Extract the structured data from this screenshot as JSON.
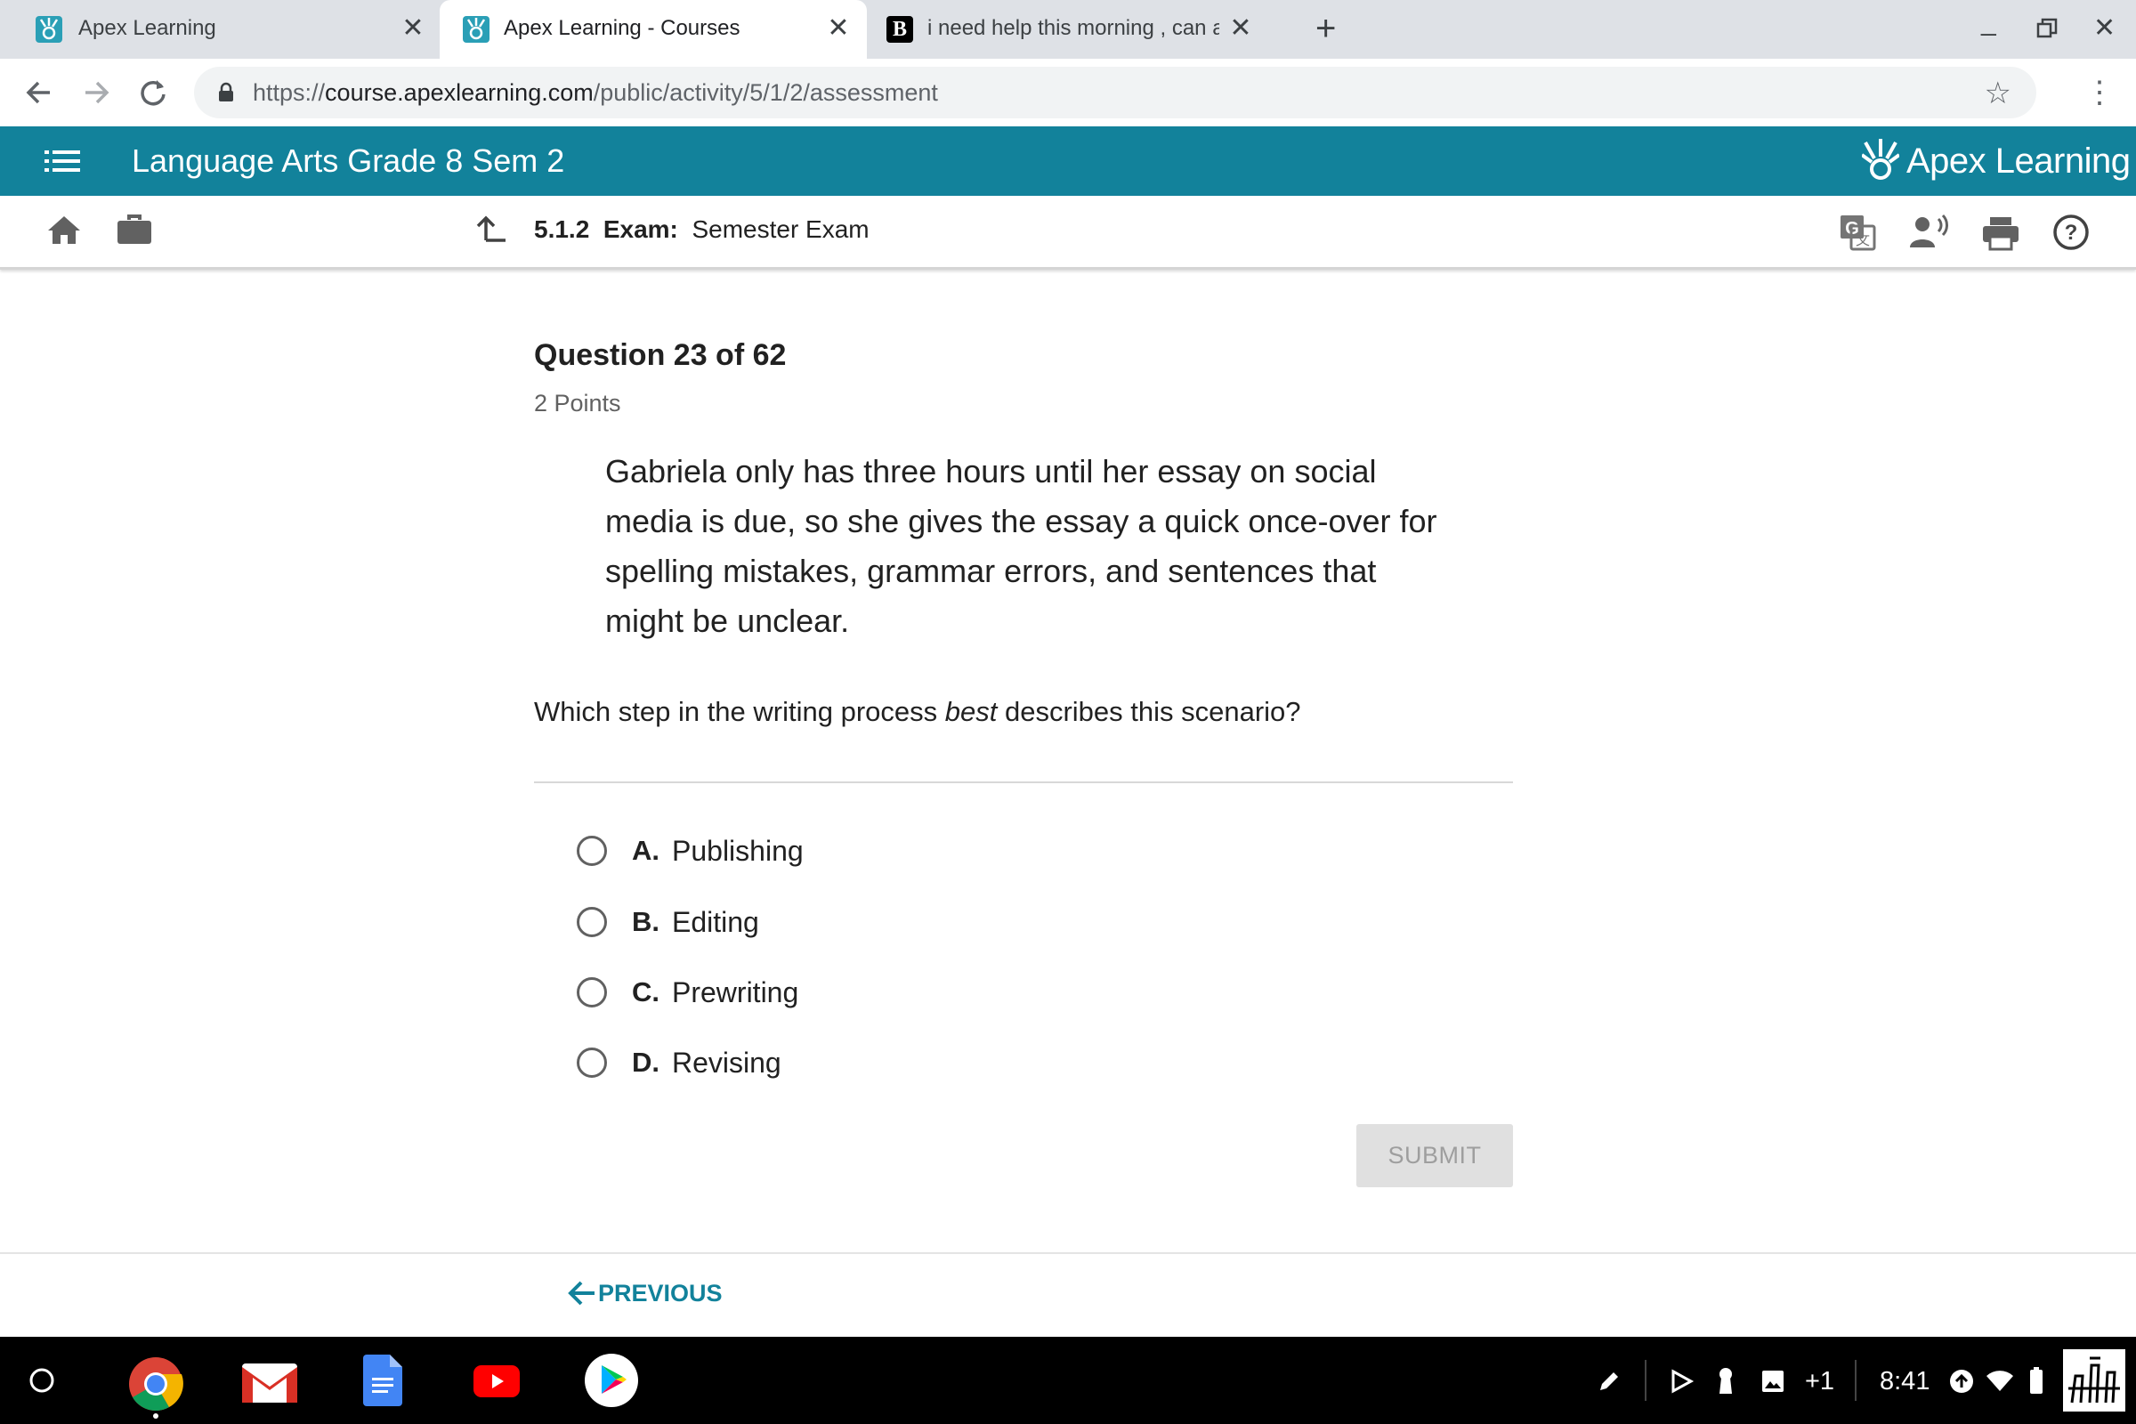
{
  "browser": {
    "tabs": [
      {
        "title": "Apex Learning",
        "active": false
      },
      {
        "title": "Apex Learning - Courses",
        "active": true
      },
      {
        "title": "i need help this morning , can an",
        "active": false
      }
    ],
    "url": {
      "scheme": "https://",
      "host": "course.apexlearning.com",
      "path": "/public/activity/5/1/2/assessment"
    }
  },
  "header": {
    "course_title": "Language Arts Grade 8 Sem 2",
    "brand": "Apex Learning",
    "brand_color": "#12829b"
  },
  "subnav": {
    "activity_number": "5.1.2",
    "activity_type": "Exam:",
    "activity_name": "Semester Exam",
    "icons": [
      "home-icon",
      "briefcase-icon",
      "translate-icon",
      "text-to-speech-icon",
      "print-icon",
      "help-icon"
    ]
  },
  "question": {
    "heading": "Question 23 of 62",
    "points": "2 Points",
    "passage": "Gabriela only has three hours until her essay on social media is due, so she gives the essay a quick once-over for spelling mistakes, grammar errors, and sentences that might be unclear.",
    "prompt_before": "Which step in the writing process ",
    "prompt_emphasis": "best",
    "prompt_after": " describes this scenario?",
    "choices": [
      {
        "letter": "A.",
        "text": "Publishing"
      },
      {
        "letter": "B.",
        "text": "Editing"
      },
      {
        "letter": "C.",
        "text": "Prewriting"
      },
      {
        "letter": "D.",
        "text": "Revising"
      }
    ],
    "submit_label": "SUBMIT"
  },
  "footer": {
    "previous_label": "PREVIOUS"
  },
  "shelf": {
    "apps": [
      "launcher-icon",
      "chrome-icon",
      "gmail-icon",
      "docs-icon",
      "youtube-icon",
      "play-store-icon"
    ],
    "notification_count": "+1",
    "time": "8:41"
  }
}
